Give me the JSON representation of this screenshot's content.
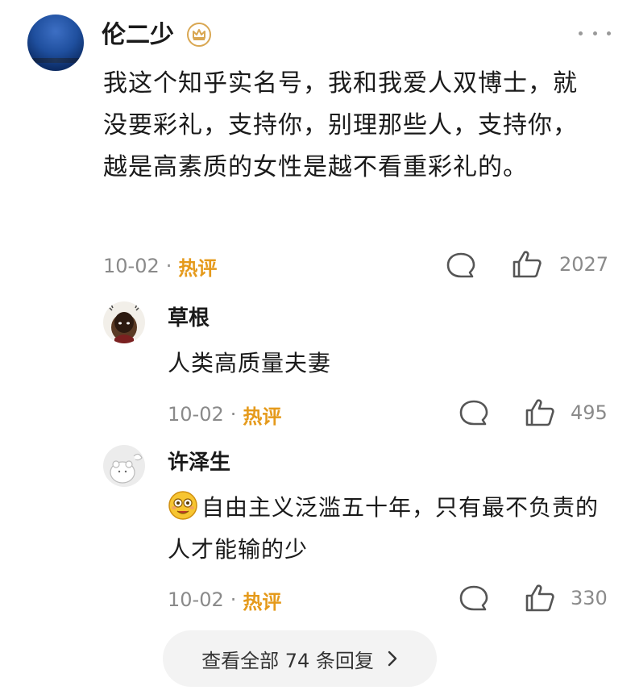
{
  "main_comment": {
    "author": "伦二少",
    "text": "我这个知乎实名号，我和我爱人双博士，就没要彩礼，支持你，别理那些人，支持你，越是高素质的女性是越不看重彩礼的。",
    "date": "10-02",
    "tag": "热评",
    "likes": "2027"
  },
  "replies": [
    {
      "author": "草根",
      "text": "人类高质量夫妻",
      "date": "10-02",
      "tag": "热评",
      "likes": "495"
    },
    {
      "author": "许泽生",
      "text": "自由主义泛滥五十年，只有最不负责的人才能输的少",
      "date": "10-02",
      "tag": "热评",
      "likes": "330"
    }
  ],
  "view_all": {
    "label": "查看全部 74 条回复"
  },
  "colors": {
    "hot_tag": "#e59a1b",
    "meta": "#8a8a8a",
    "badge": "#d9a752"
  },
  "icons": [
    "more-icon",
    "badge-icon",
    "comment-icon",
    "like-icon",
    "emoji-icon",
    "chevron-right-icon"
  ]
}
